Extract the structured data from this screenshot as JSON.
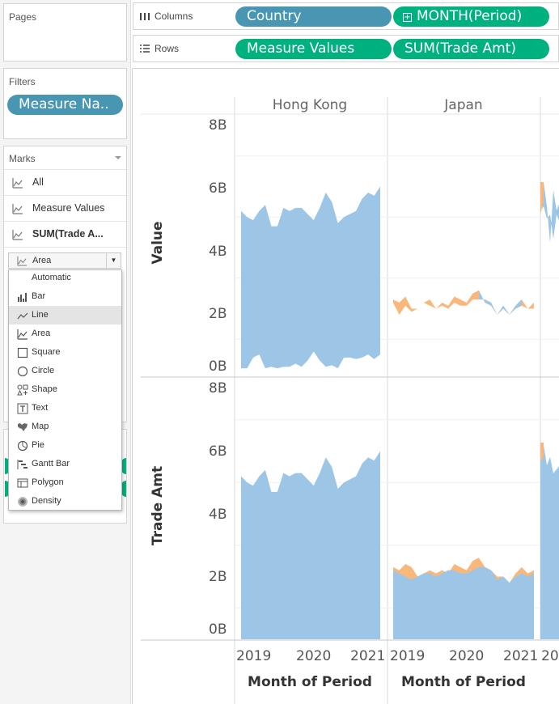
{
  "panes": {
    "pages_title": "Pages",
    "filters_title": "Filters",
    "filter_pill": "Measure Na..",
    "marks_title": "Marks",
    "marks_rows": [
      "All",
      "Measure Values",
      "SUM(Trade A..."
    ],
    "mark_type_selected": "Area",
    "mark_type_menu": [
      "Automatic",
      "Bar",
      "Line",
      "Area",
      "Square",
      "Circle",
      "Shape",
      "Text",
      "Map",
      "Pie",
      "Gantt Bar",
      "Polygon",
      "Density"
    ],
    "highlighted_menu_item": "Line"
  },
  "shelves": {
    "columns_label": "Columns",
    "rows_label": "Rows",
    "columns_pills": [
      "Country",
      "MONTH(Period)"
    ],
    "rows_pills": [
      "Measure Values",
      "SUM(Trade Amt)"
    ]
  },
  "view": {
    "column_headers": [
      "Hong Kong",
      "Japan"
    ],
    "row_axis_labels": [
      "Value",
      "Trade Amt"
    ],
    "x_axis_title": "Month of Period",
    "x_ticks": [
      "2019",
      "2020",
      "2021"
    ],
    "x_tick_partial": "20",
    "y_ticks": [
      "0B",
      "2B",
      "4B",
      "6B",
      "8B"
    ]
  },
  "colors": {
    "blue_series": "#9dc6e6",
    "orange_series": "#f8b87c",
    "pill_blue": "#4996b2",
    "pill_green": "#00b180"
  },
  "chart_data": {
    "type": "area",
    "ylim": [
      0,
      8
    ],
    "y_unit": "B",
    "panels": [
      {
        "row": "Value",
        "column": "Hong Kong",
        "series": [
          {
            "values": [
              5.2,
              5.0,
              4.9,
              5.2,
              5.4,
              4.7,
              4.7,
              5.3,
              5.2,
              5.3,
              5.3,
              5.1,
              4.9,
              5.3,
              5.8,
              5.5,
              4.8,
              5.0,
              5.1,
              5.2,
              5.6,
              5.8,
              5.7,
              6.0
            ]
          },
          {
            "values": [
              0.05,
              0.05,
              0.4,
              0.5,
              0.05,
              0.1,
              0.05,
              0.1,
              0.1,
              0.2,
              0.1,
              0.3,
              0.6,
              0.3,
              0.1,
              0.15,
              0.05,
              0.4,
              0.4,
              0.35,
              0.4,
              0.5,
              0.35,
              0.5
            ]
          }
        ]
      },
      {
        "row": "Value",
        "column": "Japan",
        "series": [
          {
            "values": [
              2.3,
              2.2,
              2.4,
              2.0,
              2.0,
              2.2,
              2.3,
              2.0,
              2.2,
              2.1,
              2.4,
              2.3,
              2.2,
              2.5,
              2.6,
              2.2,
              2.1,
              1.8,
              2.0,
              1.8,
              2.1,
              2.3,
              2.0,
              2.2
            ]
          },
          {
            "values": [
              2.2,
              1.8,
              2.1,
              1.9,
              2.0,
              2.2,
              2.1,
              2.0,
              2.1,
              2.0,
              2.2,
              2.1,
              2.1,
              2.3,
              2.3,
              2.3,
              2.2,
              1.8,
              2.1,
              1.8,
              2.0,
              2.1,
              2.0,
              2.0
            ]
          }
        ]
      },
      {
        "row": "Trade Amt",
        "column": "Hong Kong",
        "series": [
          {
            "values": [
              5.2,
              5.0,
              4.9,
              5.2,
              5.4,
              4.7,
              4.7,
              5.3,
              5.2,
              5.3,
              5.3,
              5.1,
              4.9,
              5.3,
              5.8,
              5.5,
              4.8,
              5.0,
              5.1,
              5.2,
              5.6,
              5.8,
              5.7,
              6.0
            ]
          }
        ]
      },
      {
        "row": "Trade Amt",
        "column": "Japan",
        "series": [
          {
            "values": [
              2.3,
              2.2,
              2.4,
              2.3,
              2.0,
              2.1,
              2.2,
              2.1,
              2.2,
              2.1,
              2.4,
              2.3,
              2.2,
              2.5,
              2.6,
              2.3,
              2.2,
              2.0,
              2.0,
              1.8,
              2.1,
              2.3,
              2.1,
              2.2
            ]
          },
          {
            "values": [
              2.2,
              2.1,
              2.0,
              1.9,
              2.0,
              2.1,
              2.1,
              2.0,
              2.1,
              2.2,
              2.2,
              2.1,
              2.1,
              2.2,
              2.3,
              2.3,
              2.2,
              1.9,
              2.0,
              1.8,
              2.0,
              2.1,
              2.0,
              2.1
            ]
          }
        ]
      }
    ]
  }
}
